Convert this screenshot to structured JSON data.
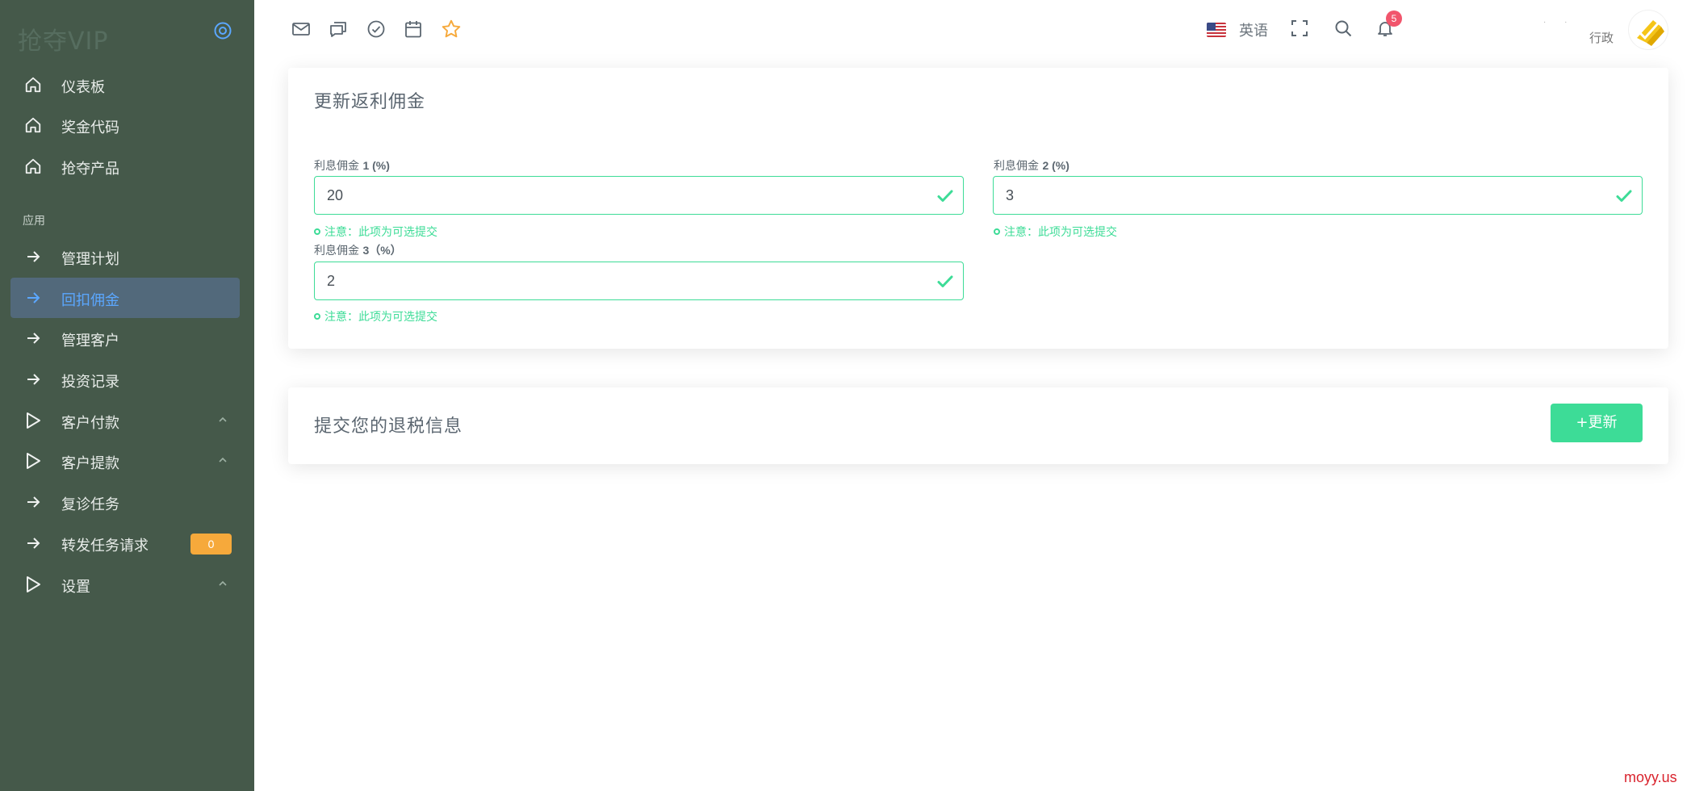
{
  "sidebar": {
    "brand": "抢夺VIP",
    "section_title": "应用",
    "items": [
      {
        "label": "仪表板",
        "icon": "home-icon"
      },
      {
        "label": "奖金代码",
        "icon": "home-icon"
      },
      {
        "label": "抢夺产品",
        "icon": "home-icon"
      },
      {
        "label": "管理计划",
        "icon": "arrow-right-icon"
      },
      {
        "label": "回扣佣金",
        "icon": "arrow-right-icon",
        "active": true
      },
      {
        "label": "管理客户",
        "icon": "arrow-right-icon"
      },
      {
        "label": "投资记录",
        "icon": "arrow-right-icon"
      },
      {
        "label": "客户付款",
        "icon": "play-icon",
        "chevron": true
      },
      {
        "label": "客户提款",
        "icon": "play-icon",
        "chevron": true
      },
      {
        "label": "复诊任务",
        "icon": "arrow-right-icon"
      },
      {
        "label": "转发任务请求",
        "icon": "arrow-right-icon",
        "badge": "0"
      },
      {
        "label": "设置",
        "icon": "play-icon",
        "chevron": true
      }
    ]
  },
  "topbar": {
    "icons": [
      "mail-icon",
      "chat-icon",
      "check-circle-icon",
      "calendar-icon",
      "star-icon"
    ],
    "language": "英语",
    "notification_count": "5",
    "user_name": "· ·",
    "user_role": "行政"
  },
  "card1": {
    "title": "更新返利佣金",
    "fields": [
      {
        "label_prefix": "利息佣金",
        "label_num": "1 (%)",
        "value": "20",
        "hint": "注意：此项为可选提交"
      },
      {
        "label_prefix": "利息佣金",
        "label_num": "2 (%)",
        "value": "3",
        "hint": "注意：此项为可选提交"
      },
      {
        "label_prefix": "利息佣金",
        "label_num": "3（%）",
        "value": "2",
        "hint": "注意：此项为可选提交"
      }
    ]
  },
  "card2": {
    "title": "提交您的退税信息",
    "button_label": "更新"
  },
  "watermark": "moyy.us",
  "colors": {
    "sidebar_bg": "#45594a",
    "active_bg": "#52697b",
    "accent_blue": "#5ba7ff",
    "success": "#3ddc97",
    "warning": "#f6a93b",
    "danger": "#f1556c"
  }
}
